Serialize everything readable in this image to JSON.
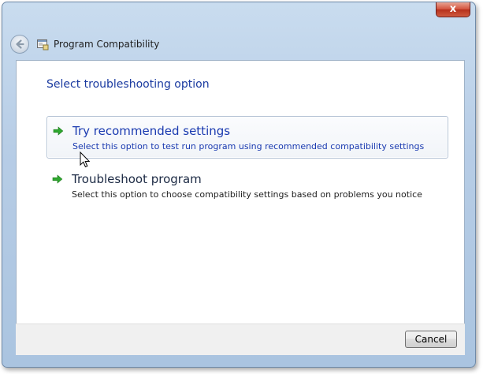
{
  "window": {
    "title": "Program Compatibility",
    "close_label": "x"
  },
  "main": {
    "heading": "Select troubleshooting option",
    "options": [
      {
        "title": "Try recommended settings",
        "description": "Select this option to test run program using recommended compatibility settings",
        "highlighted": true,
        "icon": "green-arrow-icon"
      },
      {
        "title": "Troubleshoot program",
        "description": "Select this option to choose compatibility settings based on problems you notice",
        "highlighted": false,
        "icon": "green-arrow-icon"
      }
    ]
  },
  "footer": {
    "cancel_label": "Cancel"
  },
  "colors": {
    "link_blue": "#1a3ab0",
    "arrow_green": "#2fa82f",
    "title_bar": "#b7cde6"
  }
}
